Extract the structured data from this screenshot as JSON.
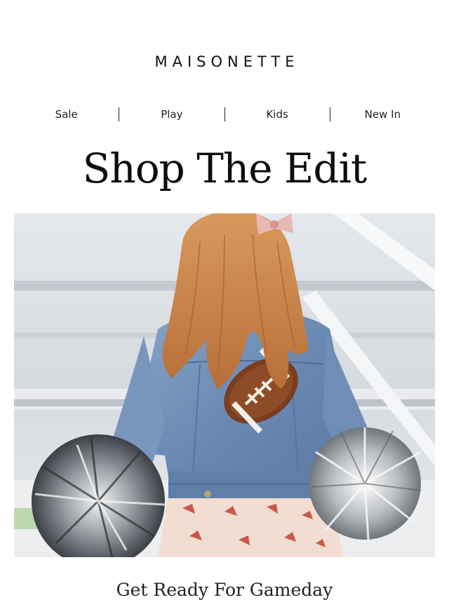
{
  "brand": {
    "name": "MAISONETTE"
  },
  "nav": {
    "items": [
      {
        "label": "Sale"
      },
      {
        "label": "Play"
      },
      {
        "label": "Kids"
      },
      {
        "label": "New In"
      }
    ]
  },
  "headline": "Shop The Edit",
  "hero": {
    "subject": "girl-in-denim-jacket-with-football-patch-and-pom-poms",
    "colors": {
      "denim": "#6f8fb6",
      "hair": "#c8824a",
      "football": "#7a3d1f",
      "background": "#dde1e6"
    }
  },
  "section": {
    "title": "Get Ready For Gameday"
  }
}
